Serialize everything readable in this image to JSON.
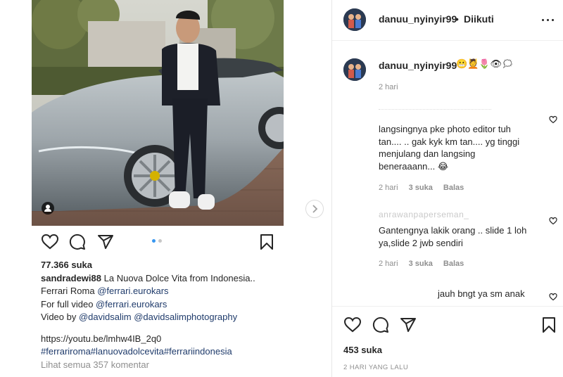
{
  "post_screenshot": {
    "likes": "77.366 suka",
    "caption_user": "sandradewi88",
    "caption_lines": [
      "La Nuova Dolce Vita from Indonesia..",
      "Ferrari Roma ",
      "For full video "
    ],
    "mention_eurokars": "@ferrari.eurokars",
    "video_by": "Video by ",
    "mention_davidsalim": "@davidsalim",
    "mention_davidsalimphotography": "@davidsalimphotography",
    "youtube_link": "https://youtu.be/lmhw4IB_2q0",
    "hashtags": "#ferrariroma#lanuovadolcevita#ferrariindonesia",
    "view_comments": "Lihat semua 357 komentar"
  },
  "header": {
    "username": "danuu_nyinyir99",
    "separator": "•",
    "follow_status": "Diikuti"
  },
  "caption": {
    "username": "danuu_nyinyir99",
    "emoji": "😬💆🌷👁🗯",
    "time": "2 hari"
  },
  "comments": [
    {
      "username_faded": "",
      "text": "langsingnya pke photo editor tuh tan.... .. gak kyk km tan.... yg tinggi menjulang dan langsing beneraaann... 😂",
      "time": "2 hari",
      "likes": "3 suka",
      "reply": "Balas"
    },
    {
      "username_faded": "anrawanpaperseman_",
      "text": "Gantengnya lakik orang .. slide 1 loh ya,slide 2 jwb sendiri",
      "time": "2 hari",
      "likes": "3 suka",
      "reply": "Balas"
    },
    {
      "username_faded": "",
      "text": "jauh bngt ya sm anak"
    }
  ],
  "footer": {
    "likes": "453 suka",
    "time": "2 HARI YANG LALU"
  },
  "colors": {
    "link": "#1f3b6b",
    "muted": "#8e8e8e",
    "dot_active": "#3897f0",
    "car_body": "#a9b1b6"
  },
  "icons": [
    "heart-icon",
    "comment-icon",
    "share-icon",
    "bookmark-icon",
    "more-icon",
    "chevron-right-icon",
    "user-tag-icon"
  ]
}
